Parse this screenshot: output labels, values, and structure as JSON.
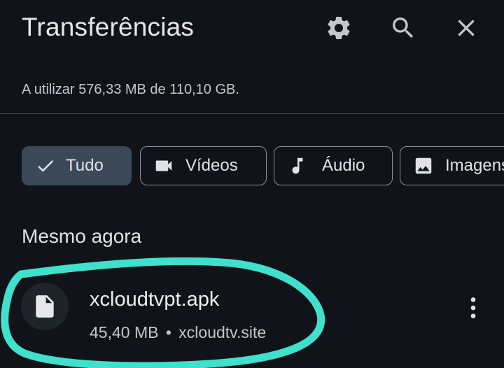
{
  "header": {
    "title": "Transferências",
    "settings_icon": "gear-icon",
    "search_icon": "search-icon",
    "close_icon": "close-icon"
  },
  "storage": {
    "text": "A utilizar 576,33 MB de 110,10 GB."
  },
  "filters": [
    {
      "label": "Tudo",
      "icon": "check-icon",
      "selected": true
    },
    {
      "label": "Vídeos",
      "icon": "video-camera-icon",
      "selected": false
    },
    {
      "label": "Áudio",
      "icon": "music-note-icon",
      "selected": false
    },
    {
      "label": "Imagens",
      "icon": "image-icon",
      "selected": false
    }
  ],
  "section": {
    "label": "Mesmo agora"
  },
  "downloads": [
    {
      "name": "xcloudtvpt.apk",
      "size": "45,40 MB",
      "separator": "•",
      "source": "xcloudtv.site",
      "icon": "file-icon",
      "menu_icon": "more-vertical-icon"
    }
  ],
  "colors": {
    "background": "#101418",
    "chip_selected": "#3a4858",
    "chip_border": "#8c9199",
    "annotation_stroke": "#3fe0cc"
  }
}
